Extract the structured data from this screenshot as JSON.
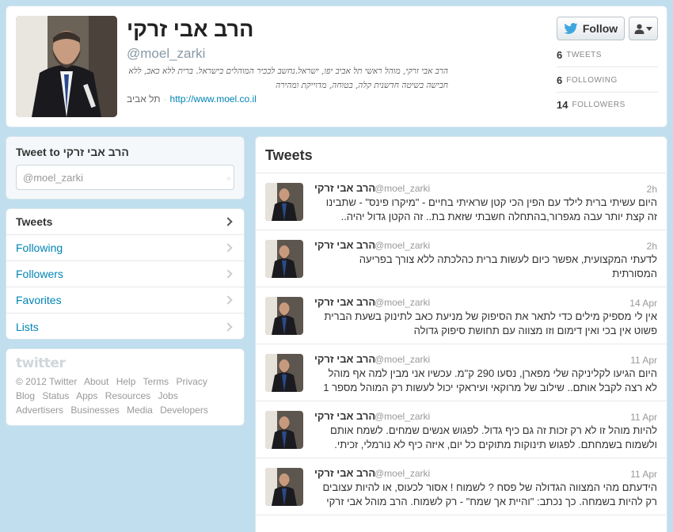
{
  "profile": {
    "name": "הרב אבי זרקי",
    "handle": "@moel_zarki",
    "bio": "הרב אבי זרקי, מוהל ראשי תל אביב יפו, ישראל.נחשב לבכיר המוהלים בישראל. ברית ללא כאב, ללא חבישה בשיטה חדשנית קלה, בטוחה, מדוייקת ומהירה",
    "location": "תל אביב",
    "url": "http://www.moel.co.il",
    "follow_label": "Follow",
    "stats": [
      {
        "value": "6",
        "label": "TWEETS"
      },
      {
        "value": "6",
        "label": "FOLLOWING"
      },
      {
        "value": "14",
        "label": "FOLLOWERS"
      }
    ]
  },
  "compose": {
    "title": "Tweet to הרב אבי זרקי",
    "value": "@moel_zarki"
  },
  "nav": {
    "items": [
      {
        "label": "Tweets"
      },
      {
        "label": "Following"
      },
      {
        "label": "Followers"
      },
      {
        "label": "Favorites"
      },
      {
        "label": "Lists"
      }
    ]
  },
  "footer": {
    "logo": "twitter",
    "links": [
      "© 2012 Twitter",
      "About",
      "Help",
      "Terms",
      "Privacy",
      "Blog",
      "Status",
      "Apps",
      "Resources",
      "Jobs",
      "Advertisers",
      "Businesses",
      "Media",
      "Developers"
    ]
  },
  "timeline": {
    "title": "Tweets",
    "tweets": [
      {
        "name": "הרב אבי זרקי",
        "handle": "@moel_zarki",
        "time": "2h",
        "text": "היום עשיתי ברית לילד עם הפין הכי קטן שראיתי בחיים - \"מיקרו פינס\" - שתבינו זה קצת יותר עבה מגפרור,בהתחלה חשבתי שזאת בת.. זה הקטן גדול יהיה.."
      },
      {
        "name": "הרב אבי זרקי",
        "handle": "@moel_zarki",
        "time": "2h",
        "text": "לדעתי המקצועית, אפשר כיום לעשות ברית כהלכתה ללא צורך בפריעה המסורתית"
      },
      {
        "name": "הרב אבי זרקי",
        "handle": "@moel_zarki",
        "time": "14 Apr",
        "text": "אין לי מספיק מילים כדי לתאר את הסיפוק של מניעת כאב לתינוק בשעת הברית פשוט אין בכי ואין דימום וזו מצווה עם תחושת סיפוק גדולה"
      },
      {
        "name": "הרב אבי זרקי",
        "handle": "@moel_zarki",
        "time": "11 Apr",
        "text": "היום הגיעו לקליניקה שלי מפארן, נסעו 290 ק\"מ. עכשיו אני מבין למה אף מוהל לא רצה לקבל אותם.. שילוב של מרוקאי ועיראקי יכול לעשות רק המוהל מספר 1"
      },
      {
        "name": "הרב אבי זרקי",
        "handle": "@moel_zarki",
        "time": "11 Apr",
        "text": "להיות מוהל זו לא רק זכות זה גם כיף גדול. לפגוש אנשים שמחים. לשמח אותם ולשמוח בשמחתם. לפגוש תינוקות מתוקים כל יום, איזה כיף לא נורמלי, זכיתי."
      },
      {
        "name": "הרב אבי זרקי",
        "handle": "@moel_zarki",
        "time": "11 Apr",
        "text": "הידעתם מהי המצווה הגדולה של פסח ? לשמוח ! אסור לכעוס, או להיות עצובים רק להיות בשמחה. כך נכתב: \"והיית אך שמח\" - רק לשמוח. הרב מוהל אבי זרקי"
      }
    ]
  }
}
